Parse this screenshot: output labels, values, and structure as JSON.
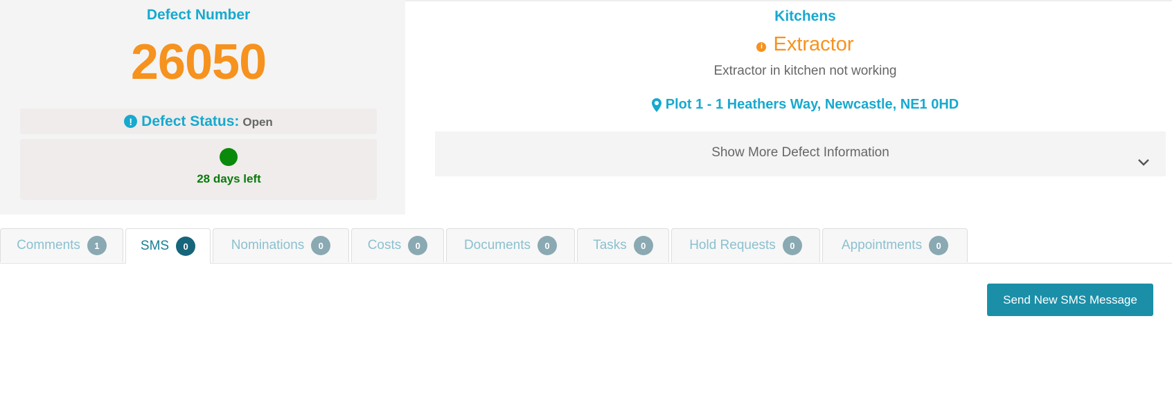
{
  "defect": {
    "number_label": "Defect Number",
    "number": "26050",
    "status_label": "Defect Status:",
    "status_value": "Open",
    "days_left": "28 days left",
    "days_status_color": "#0a8a0a"
  },
  "details": {
    "category": "Kitchens",
    "item": "Extractor",
    "description": "Extractor in kitchen not working",
    "address": "Plot 1 - 1 Heathers Way, Newcastle, NE1 0HD",
    "more_info_label": "Show More Defect Information"
  },
  "tabs": [
    {
      "label": "Comments",
      "count": "1",
      "active": false
    },
    {
      "label": "SMS",
      "count": "0",
      "active": true
    },
    {
      "label": "Nominations",
      "count": "0",
      "active": false
    },
    {
      "label": "Costs",
      "count": "0",
      "active": false
    },
    {
      "label": "Documents",
      "count": "0",
      "active": false
    },
    {
      "label": "Tasks",
      "count": "0",
      "active": false
    },
    {
      "label": "Hold Requests",
      "count": "0",
      "active": false
    },
    {
      "label": "Appointments",
      "count": "0",
      "active": false
    }
  ],
  "actions": {
    "send_sms_label": "Send New SMS Message"
  },
  "colors": {
    "accent": "#17a9cf",
    "orange": "#f6921e",
    "button": "#1b8fa8"
  }
}
